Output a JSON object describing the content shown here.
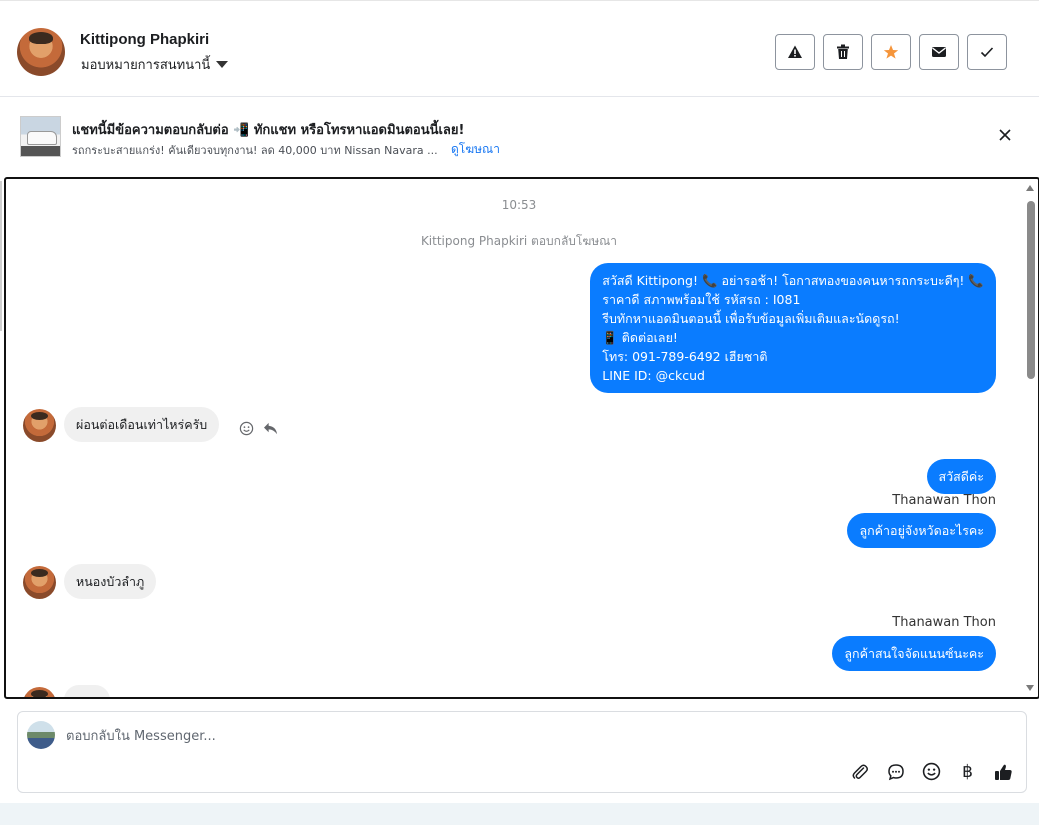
{
  "header": {
    "contact_name": "Kittipong Phapkiri",
    "assign_label": "มอบหมายการสนทนานี้"
  },
  "header_actions": [
    "warning-icon",
    "trash-icon",
    "star-icon",
    "envelope-icon",
    "check-icon"
  ],
  "ad": {
    "title": "แชทนี้มีข้อความตอบกลับต่อ 📲 ทักแชท หรือโทรหาแอดมินตอนนี้เลย!",
    "subtitle": "รถกระบะสายแกร่ง! คันเดียวจบทุกงาน! ลด 40,000 บาท Nissan Navara ...",
    "link": "ดูโฆษณา"
  },
  "chat": {
    "timestamp": "10:53",
    "system_note": "Kittipong Phapkiri ตอบกลับโฆษณา",
    "first_outgoing": {
      "line1": "สวัสดี Kittipong! 📞 อย่ารอช้า! โอกาสทองของคนหารถกระบะดีๆ! 📞",
      "line2": "ราคาดี สภาพพร้อมใช้ รหัสรถ : I081",
      "line3": "รีบทักหาแอดมินตอนนี้ เพื่อรับข้อมูลเพิ่มเติมและนัดดูรถ!",
      "line4": "📱 ติดต่อเลย!",
      "line5": "โทร: 091-789-6492 เฮียชาติ",
      "line6": "LINE ID: @ckcud"
    },
    "incoming_1": "ผ่อนต่อเดือนเท่าไหร่ครับ",
    "outgoing_2": "สวัสดีค่ะ",
    "sender_1": "Thanawan Thon",
    "outgoing_3": "ลูกค้าอยู่จังหวัดอะไรคะ",
    "incoming_2": "หนองบัวลำภู",
    "sender_2": "Thanawan Thon",
    "outgoing_4": "ลูกค้าสนใจจัดแนนซ์นะคะ"
  },
  "composer": {
    "placeholder": "ตอบกลับใน Messenger...",
    "tools": [
      "paperclip-icon",
      "chat-bubble-icon",
      "smiley-icon",
      "baht-icon",
      "thumbs-up-icon"
    ],
    "baht_symbol": "฿"
  },
  "colors": {
    "accent": "#0a7cff",
    "star": "#f5953b",
    "incoming_bubble": "#f0f0f0"
  }
}
